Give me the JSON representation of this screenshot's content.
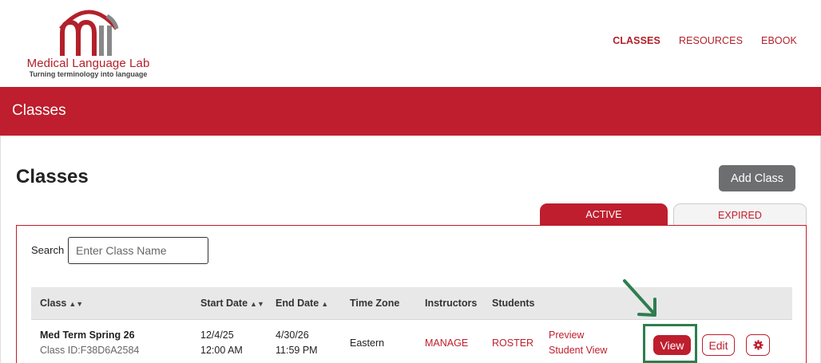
{
  "brand": {
    "name": "Medical Language Lab",
    "tagline": "Turning terminology into language",
    "color": "#be1e2d"
  },
  "nav": {
    "items": [
      {
        "label": "CLASSES",
        "active": true
      },
      {
        "label": "RESOURCES",
        "active": false
      },
      {
        "label": "EBOOK",
        "active": false
      }
    ]
  },
  "banner": {
    "title": "Classes"
  },
  "main": {
    "title": "Classes",
    "add_button": "Add Class",
    "tabs": {
      "active": "ACTIVE",
      "expired": "EXPIRED"
    },
    "search": {
      "label": "Search",
      "placeholder": "Enter Class Name",
      "value": ""
    },
    "table": {
      "headers": {
        "class": "Class",
        "start_date": "Start Date",
        "end_date": "End Date",
        "time_zone": "Time Zone",
        "instructors": "Instructors",
        "students": "Students"
      },
      "sort_icons": {
        "class": "sort-both-icon",
        "start_date": "sort-both-icon",
        "end_date": "sort-ascending-icon"
      },
      "rows": [
        {
          "class_name": "Med Term Spring 26",
          "class_id": "Class ID:F38D6A2584",
          "start_date": "12/4/25",
          "start_time": "12:00 AM",
          "end_date": "4/30/26",
          "end_time": "11:59 PM",
          "time_zone": "Eastern",
          "instructors": "MANAGE",
          "students": "ROSTER",
          "preview": "Preview",
          "student_view": "Student View",
          "view_button": "View",
          "edit_button": "Edit",
          "settings_icon": "gear-icon"
        }
      ]
    }
  },
  "annotation": {
    "highlight_color": "#2e7d4f",
    "arrow_icon": "arrow-down-right-icon"
  }
}
